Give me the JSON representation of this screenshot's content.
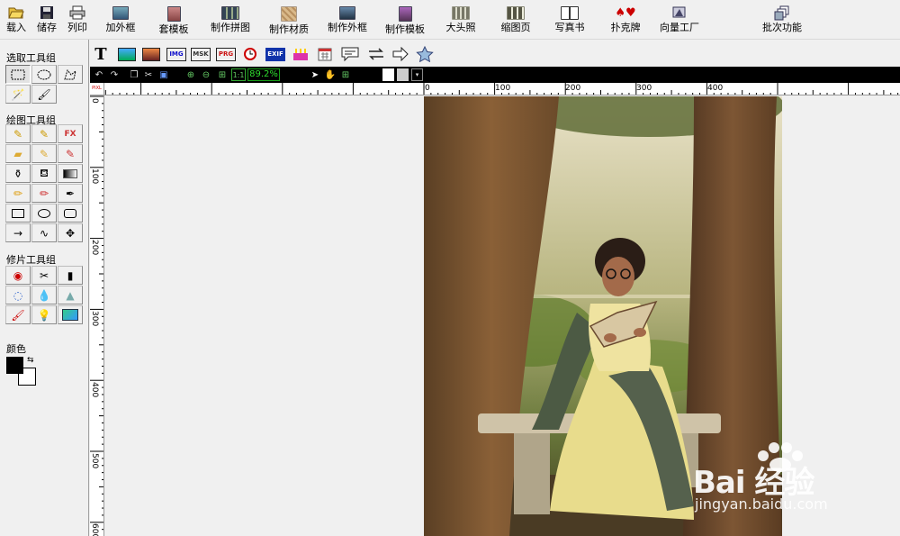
{
  "toolbar": {
    "items": [
      {
        "label": "载入",
        "icon": "folder-open-icon"
      },
      {
        "label": "储存",
        "icon": "save-icon"
      },
      {
        "label": "列印",
        "icon": "printer-icon"
      },
      {
        "label": "加外框",
        "icon": "frame-icon"
      },
      {
        "label": "套模板",
        "icon": "template-icon"
      },
      {
        "label": "制作拼图",
        "icon": "collage-icon"
      },
      {
        "label": "制作材质",
        "icon": "texture-icon"
      },
      {
        "label": "制作外框",
        "icon": "make-frame-icon"
      },
      {
        "label": "制作模板",
        "icon": "make-template-icon"
      },
      {
        "label": "大头照",
        "icon": "photo-grid-icon"
      },
      {
        "label": "缩图页",
        "icon": "thumbnail-icon"
      },
      {
        "label": "写真书",
        "icon": "photobook-icon"
      },
      {
        "label": "扑克牌",
        "icon": "card-suits-icon"
      },
      {
        "label": "向量工厂",
        "icon": "vector-icon"
      },
      {
        "label": "批次功能",
        "icon": "batch-icon"
      }
    ]
  },
  "sidebar": {
    "select_group": "选取工具组",
    "draw_group": "绘图工具组",
    "retouch_group": "修片工具组",
    "color_label": "颜色"
  },
  "tool_options": {
    "text_tool": "T",
    "img_label": "IMG",
    "msk_label": "MSK",
    "prg_label": "PRG",
    "exif_label": "EXIF"
  },
  "control_bar": {
    "zoom": "89.2%",
    "one_to_one": "1:1"
  },
  "ruler": {
    "corner": "PIXL",
    "h_ticks": [
      "0",
      "100",
      "200",
      "300",
      "400"
    ],
    "v_ticks": [
      "0",
      "100",
      "200",
      "300",
      "400",
      "500",
      "600"
    ]
  },
  "watermark": {
    "logo": "Bai 经验",
    "sub": "jingyan.baidu.com"
  },
  "colors": {
    "foreground": "#000000",
    "background": "#ffffff",
    "zoom_green": "#2fdc2f"
  }
}
